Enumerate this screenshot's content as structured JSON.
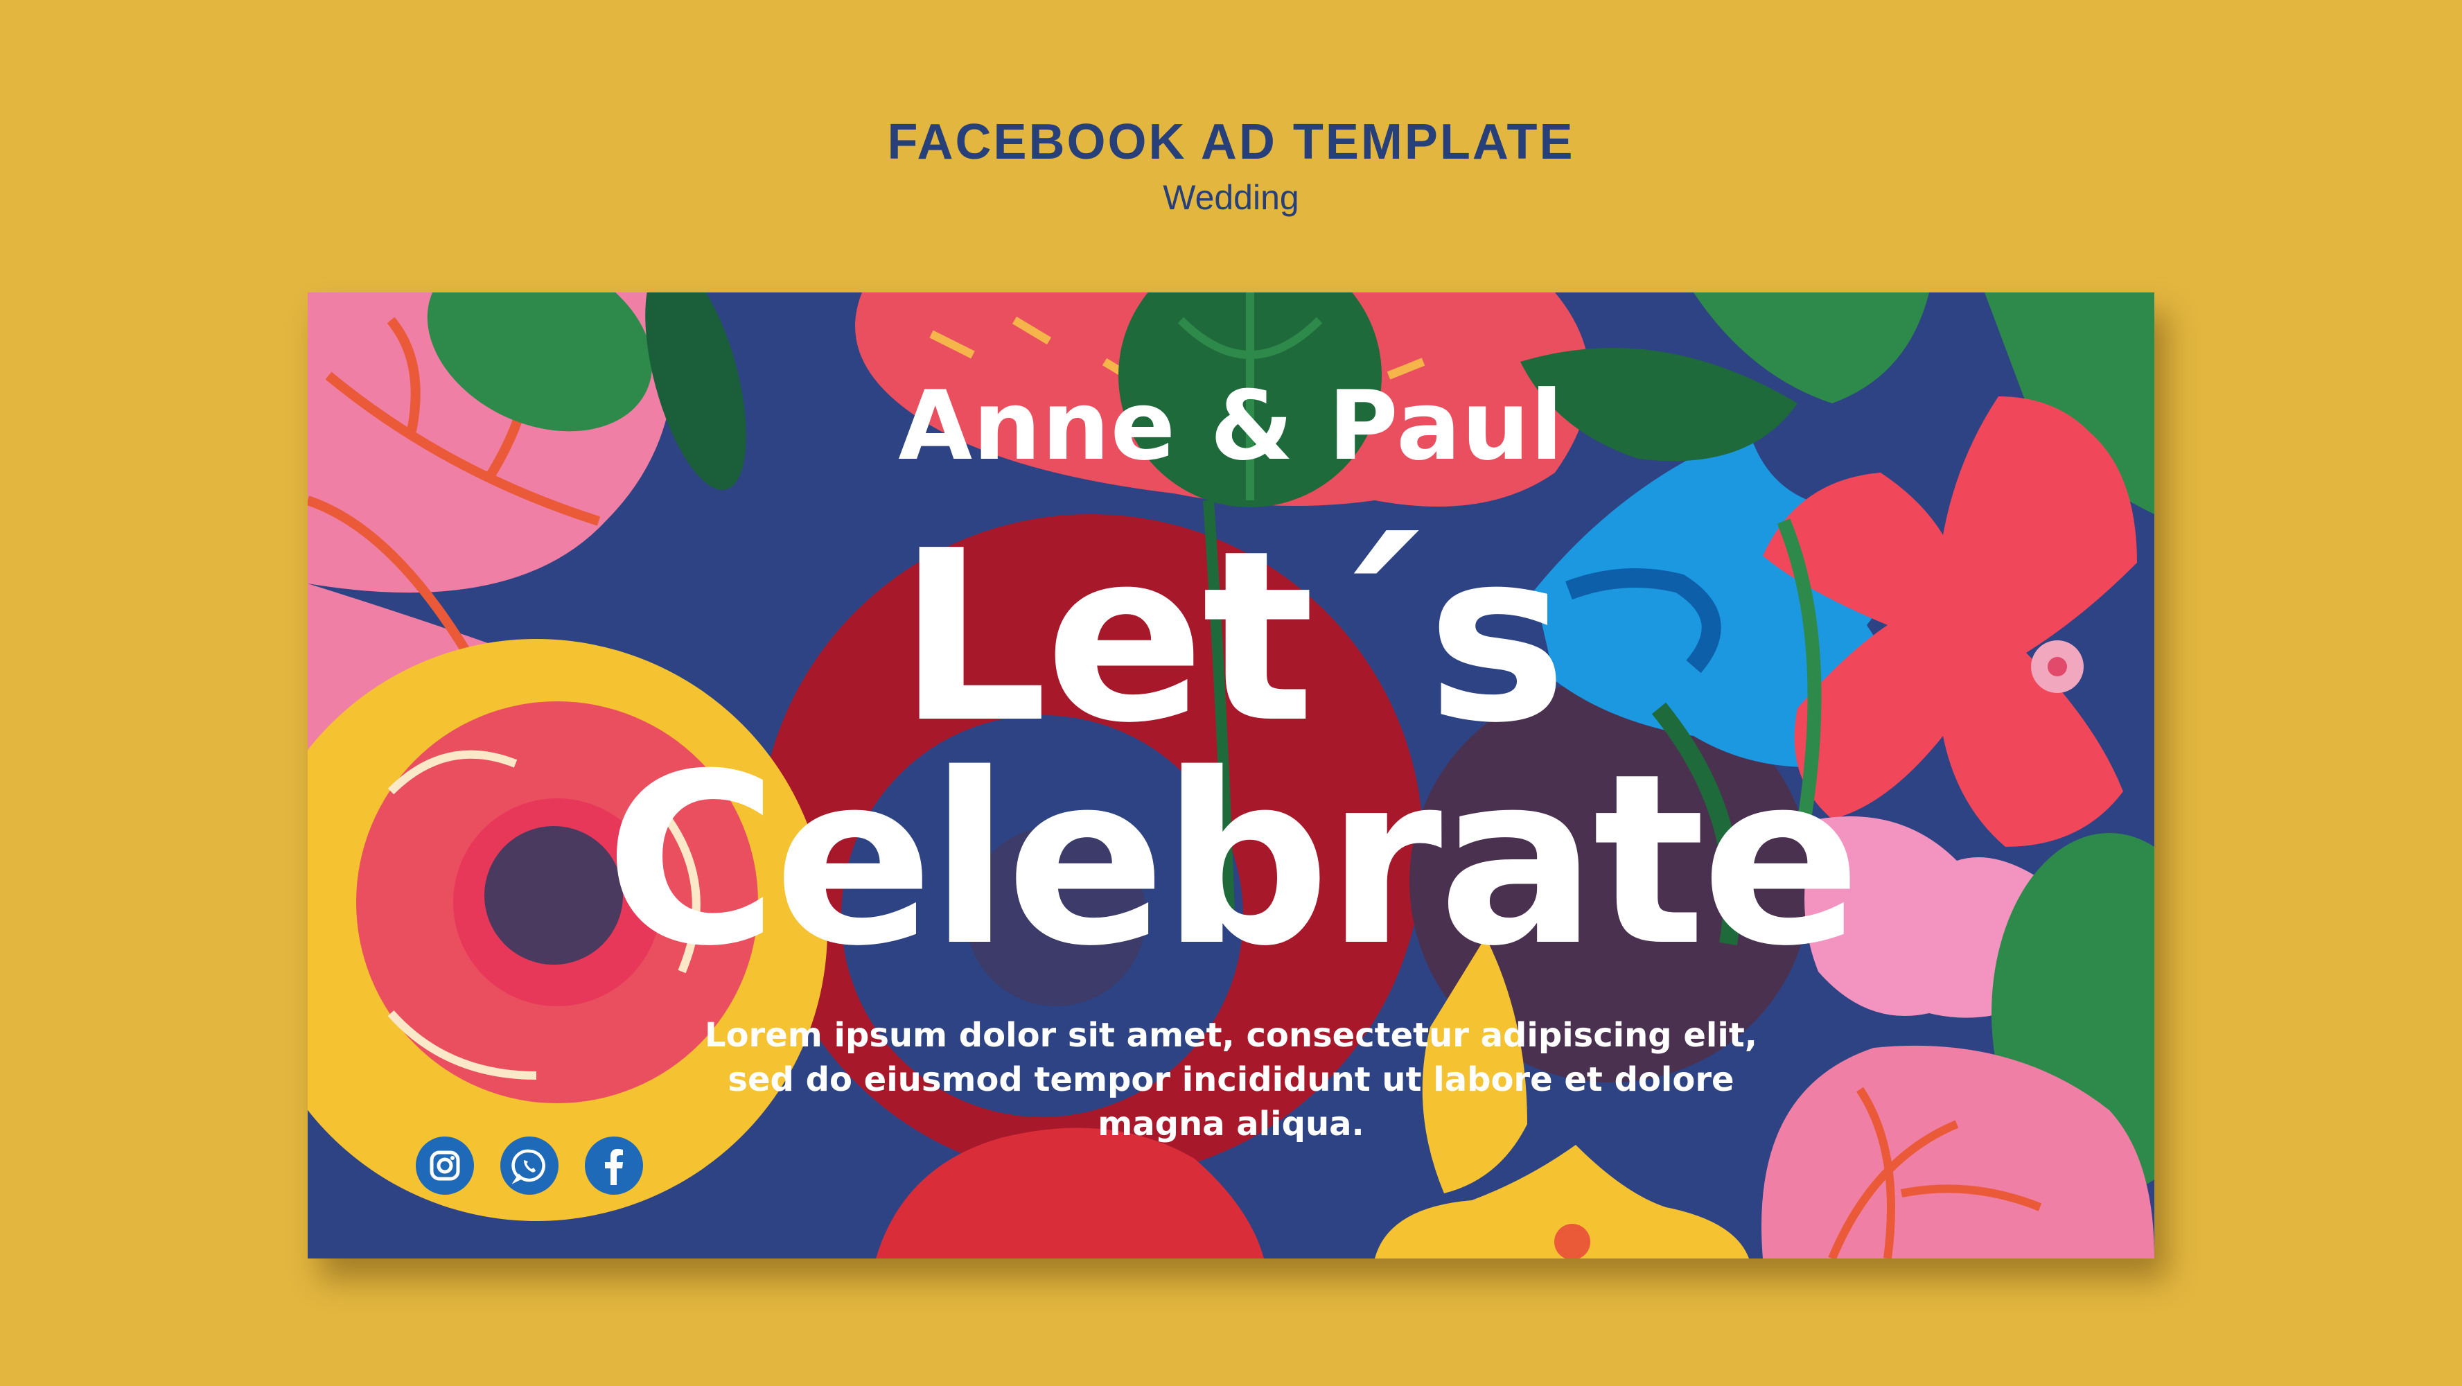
{
  "header": {
    "title": "FACEBOOK AD TEMPLATE",
    "subtitle": "Wedding"
  },
  "ad": {
    "names": "Anne & Paul",
    "headline_line1": "Let´s",
    "headline_line2": "Celebrate",
    "body": "Lorem ipsum dolor sit amet, consectetur adipiscing elit, sed do eiusmod tempor incididunt ut labore et dolore magna aliqua.",
    "social_icons": [
      "instagram-icon",
      "whatsapp-icon",
      "facebook-icon"
    ]
  },
  "colors": {
    "page_background": "#e2b63f",
    "header_text": "#27407a",
    "text_on_ad": "#ffffff",
    "icon_blue": "#1f6ab8"
  }
}
